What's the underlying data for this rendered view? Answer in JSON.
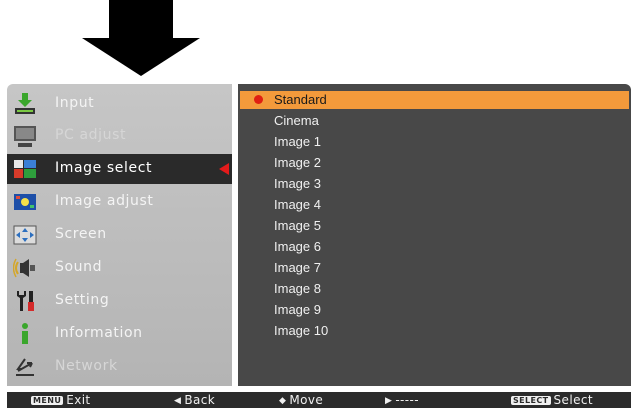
{
  "main_menu": [
    {
      "label": "Input",
      "icon": "input-icon",
      "state": "normal"
    },
    {
      "label": "PC adjust",
      "icon": "pc-adjust-icon",
      "state": "disabled"
    },
    {
      "label": "Image select",
      "icon": "image-select-icon",
      "state": "selected"
    },
    {
      "label": "Image adjust",
      "icon": "image-adjust-icon",
      "state": "normal"
    },
    {
      "label": "Screen",
      "icon": "screen-icon",
      "state": "normal"
    },
    {
      "label": "Sound",
      "icon": "sound-icon",
      "state": "normal"
    },
    {
      "label": "Setting",
      "icon": "setting-icon",
      "state": "normal"
    },
    {
      "label": "Information",
      "icon": "information-icon",
      "state": "normal"
    },
    {
      "label": "Network",
      "icon": "network-icon",
      "state": "disabled"
    }
  ],
  "submenu": {
    "items": [
      "Standard",
      "Cinema",
      "Image 1",
      "Image 2",
      "Image 3",
      "Image 4",
      "Image 5",
      "Image 6",
      "Image 7",
      "Image 8",
      "Image 9",
      "Image 10"
    ],
    "active_index": 0
  },
  "footer": {
    "exit_key": "MENU",
    "exit": "Exit",
    "back_icon": "◀",
    "back": "Back",
    "move_icon": "◆",
    "move": "Move",
    "next_icon": "▶",
    "next": "-----",
    "select_key": "SELECT",
    "select": "Select"
  },
  "colors": {
    "highlight": "#f39a3b",
    "pointer": "#e31b1b",
    "panel_dark": "#484848",
    "panel_light": "#bebebe"
  }
}
